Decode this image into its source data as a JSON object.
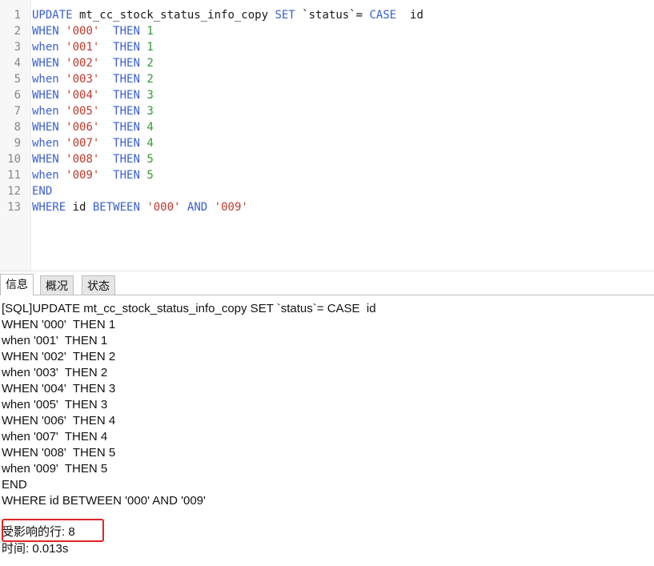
{
  "editor": {
    "line_numbers": [
      "1",
      "2",
      "3",
      "4",
      "5",
      "6",
      "7",
      "8",
      "9",
      "10",
      "11",
      "12",
      "13"
    ],
    "lines": [
      [
        {
          "t": "kw",
          "v": "UPDATE"
        },
        {
          "t": "plain",
          "v": " mt_cc_stock_status_info_copy "
        },
        {
          "t": "kw",
          "v": "SET"
        },
        {
          "t": "plain",
          "v": " `status`= "
        },
        {
          "t": "kw",
          "v": "CASE"
        },
        {
          "t": "plain",
          "v": "  id"
        }
      ],
      [
        {
          "t": "kw",
          "v": "WHEN"
        },
        {
          "t": "plain",
          "v": " "
        },
        {
          "t": "str",
          "v": "'000'"
        },
        {
          "t": "plain",
          "v": "  "
        },
        {
          "t": "kw",
          "v": "THEN"
        },
        {
          "t": "plain",
          "v": " "
        },
        {
          "t": "num",
          "v": "1"
        }
      ],
      [
        {
          "t": "kw",
          "v": "when"
        },
        {
          "t": "plain",
          "v": " "
        },
        {
          "t": "str",
          "v": "'001'"
        },
        {
          "t": "plain",
          "v": "  "
        },
        {
          "t": "kw",
          "v": "THEN"
        },
        {
          "t": "plain",
          "v": " "
        },
        {
          "t": "num",
          "v": "1"
        }
      ],
      [
        {
          "t": "kw",
          "v": "WHEN"
        },
        {
          "t": "plain",
          "v": " "
        },
        {
          "t": "str",
          "v": "'002'"
        },
        {
          "t": "plain",
          "v": "  "
        },
        {
          "t": "kw",
          "v": "THEN"
        },
        {
          "t": "plain",
          "v": " "
        },
        {
          "t": "num",
          "v": "2"
        }
      ],
      [
        {
          "t": "kw",
          "v": "when"
        },
        {
          "t": "plain",
          "v": " "
        },
        {
          "t": "str",
          "v": "'003'"
        },
        {
          "t": "plain",
          "v": "  "
        },
        {
          "t": "kw",
          "v": "THEN"
        },
        {
          "t": "plain",
          "v": " "
        },
        {
          "t": "num",
          "v": "2"
        }
      ],
      [
        {
          "t": "kw",
          "v": "WHEN"
        },
        {
          "t": "plain",
          "v": " "
        },
        {
          "t": "str",
          "v": "'004'"
        },
        {
          "t": "plain",
          "v": "  "
        },
        {
          "t": "kw",
          "v": "THEN"
        },
        {
          "t": "plain",
          "v": " "
        },
        {
          "t": "num",
          "v": "3"
        }
      ],
      [
        {
          "t": "kw",
          "v": "when"
        },
        {
          "t": "plain",
          "v": " "
        },
        {
          "t": "str",
          "v": "'005'"
        },
        {
          "t": "plain",
          "v": "  "
        },
        {
          "t": "kw",
          "v": "THEN"
        },
        {
          "t": "plain",
          "v": " "
        },
        {
          "t": "num",
          "v": "3"
        }
      ],
      [
        {
          "t": "kw",
          "v": "WHEN"
        },
        {
          "t": "plain",
          "v": " "
        },
        {
          "t": "str",
          "v": "'006'"
        },
        {
          "t": "plain",
          "v": "  "
        },
        {
          "t": "kw",
          "v": "THEN"
        },
        {
          "t": "plain",
          "v": " "
        },
        {
          "t": "num",
          "v": "4"
        }
      ],
      [
        {
          "t": "kw",
          "v": "when"
        },
        {
          "t": "plain",
          "v": " "
        },
        {
          "t": "str",
          "v": "'007'"
        },
        {
          "t": "plain",
          "v": "  "
        },
        {
          "t": "kw",
          "v": "THEN"
        },
        {
          "t": "plain",
          "v": " "
        },
        {
          "t": "num",
          "v": "4"
        }
      ],
      [
        {
          "t": "kw",
          "v": "WHEN"
        },
        {
          "t": "plain",
          "v": " "
        },
        {
          "t": "str",
          "v": "'008'"
        },
        {
          "t": "plain",
          "v": "  "
        },
        {
          "t": "kw",
          "v": "THEN"
        },
        {
          "t": "plain",
          "v": " "
        },
        {
          "t": "num",
          "v": "5"
        }
      ],
      [
        {
          "t": "kw",
          "v": "when"
        },
        {
          "t": "plain",
          "v": " "
        },
        {
          "t": "str",
          "v": "'009'"
        },
        {
          "t": "plain",
          "v": "  "
        },
        {
          "t": "kw",
          "v": "THEN"
        },
        {
          "t": "plain",
          "v": " "
        },
        {
          "t": "num",
          "v": "5"
        }
      ],
      [
        {
          "t": "kw",
          "v": "END"
        }
      ],
      [
        {
          "t": "kw",
          "v": "WHERE"
        },
        {
          "t": "plain",
          "v": " id "
        },
        {
          "t": "kw",
          "v": "BETWEEN"
        },
        {
          "t": "plain",
          "v": " "
        },
        {
          "t": "str",
          "v": "'000'"
        },
        {
          "t": "plain",
          "v": " "
        },
        {
          "t": "kw",
          "v": "AND"
        },
        {
          "t": "plain",
          "v": " "
        },
        {
          "t": "str",
          "v": "'009'"
        }
      ]
    ]
  },
  "tabs": [
    {
      "label": "信息",
      "active": true
    },
    {
      "label": "概况",
      "active": false
    },
    {
      "label": "状态",
      "active": false
    }
  ],
  "messages": {
    "sql_lines": [
      "[SQL]UPDATE mt_cc_stock_status_info_copy SET `status`= CASE  id",
      "WHEN '000'  THEN 1",
      "when '001'  THEN 1",
      "WHEN '002'  THEN 2",
      "when '003'  THEN 2",
      "WHEN '004'  THEN 3",
      "when '005'  THEN 3",
      "WHEN '006'  THEN 4",
      "when '007'  THEN 4",
      "WHEN '008'  THEN 5",
      "when '009'  THEN 5",
      "END",
      "WHERE id BETWEEN '000' AND '009'"
    ],
    "affected_rows": "受影响的行: 8",
    "time": "时间: 0.013s"
  },
  "colors": {
    "keyword": "#3a5fcd",
    "string": "#c0392b",
    "number": "#2e9a2e",
    "highlight_box": "#e32424"
  }
}
